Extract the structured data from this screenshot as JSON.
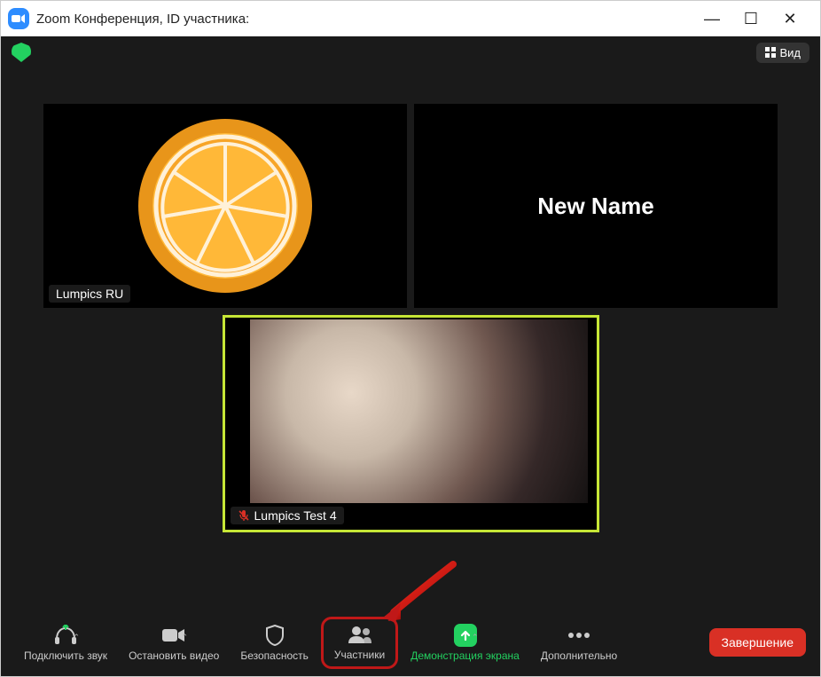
{
  "window": {
    "title": "Zoom Конференция, ID участника:"
  },
  "topbar": {
    "view_label": "Вид"
  },
  "tiles": {
    "top_left_name": "Lumpics RU",
    "top_right_text": "New Name",
    "bottom_name": "Lumpics Test 4"
  },
  "toolbar": {
    "audio": "Подключить звук",
    "video": "Остановить видео",
    "security": "Безопасность",
    "participants": "Участники",
    "share": "Демонстрация экрана",
    "more": "Дополнительно",
    "end": "Завершение"
  },
  "colors": {
    "accent_green": "#23d160",
    "accent_red": "#d93025",
    "highlight": "#c01818",
    "active_border": "#c6e636"
  }
}
